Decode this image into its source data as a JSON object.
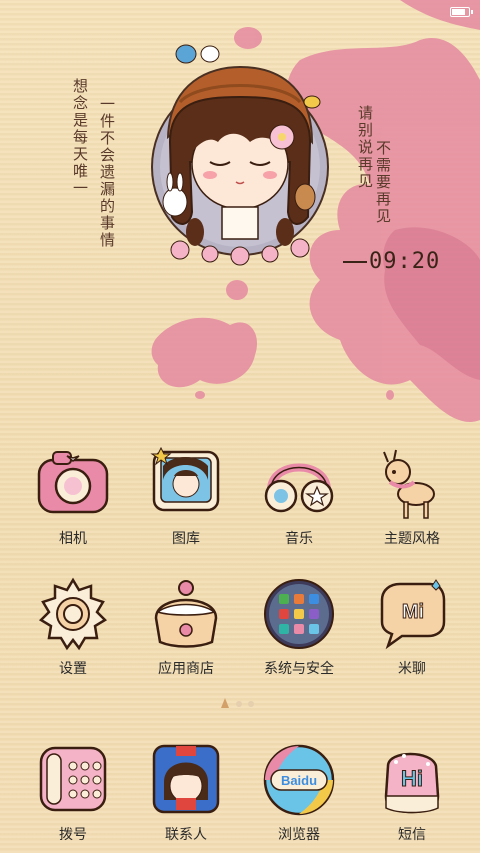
{
  "statusbar": {
    "battery_level": 0.7
  },
  "wallpaper": {
    "left_text": "想念是每天唯一",
    "left_text_2": "一件不会遗漏的事情",
    "right_text": "请别说再见",
    "right_text_2": "不需要再见",
    "clock": "09:20"
  },
  "apps": [
    {
      "name": "camera",
      "label": "相机"
    },
    {
      "name": "gallery",
      "label": "图库"
    },
    {
      "name": "music",
      "label": "音乐"
    },
    {
      "name": "themes",
      "label": "主题风格"
    },
    {
      "name": "settings",
      "label": "设置"
    },
    {
      "name": "app-store",
      "label": "应用商店"
    },
    {
      "name": "security",
      "label": "系统与安全"
    },
    {
      "name": "mitalk",
      "label": "米聊"
    }
  ],
  "dock": [
    {
      "name": "dialer",
      "label": "拨号"
    },
    {
      "name": "contacts",
      "label": "联系人"
    },
    {
      "name": "browser",
      "label": "浏览器"
    },
    {
      "name": "messages",
      "label": "短信"
    }
  ],
  "icon_text": {
    "mi": "Mi",
    "baidu": "Baidu",
    "hi": "Hi"
  },
  "colors": {
    "pink": "#e88aa8",
    "splash": "#e4899f",
    "brown": "#5a3220",
    "cream": "#fbeed8"
  }
}
